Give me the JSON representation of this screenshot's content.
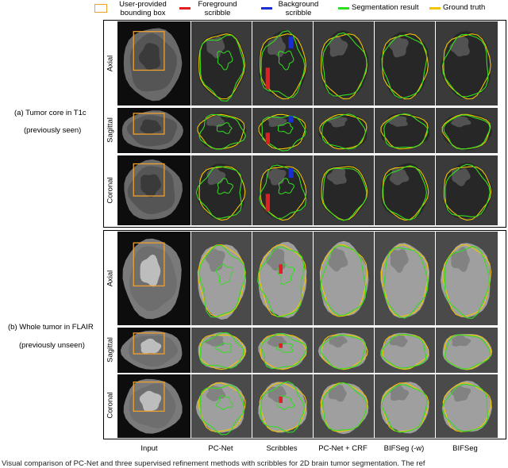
{
  "legend": {
    "bbox_label": "User-provided\nbounding box",
    "foreground_label": "Foreground\nscribble",
    "background_label": "Background\nscribble",
    "segmentation_label": "Segmentation result",
    "ground_truth_label": "Ground truth",
    "colors": {
      "bbox": "#f0a030",
      "foreground": "#e02020",
      "background": "#1a2fd0",
      "segmentation": "#33dd22",
      "ground_truth": "#f2c400"
    }
  },
  "groups": [
    {
      "title": "(a) Tumor core in T1c",
      "subtitle": "(previously seen)"
    },
    {
      "title": "(b) Whole tumor in FLAIR",
      "subtitle": "(previously unseen)"
    }
  ],
  "rows": [
    "Axial",
    "Sagittal",
    "Coronal"
  ],
  "columns": [
    "Input",
    "PC-Net",
    "Scribbles",
    "PC-Net + CRF",
    "BIFSeg (-w)",
    "BIFSeg"
  ],
  "caption": "Visual comparison of PC-Net and three supervised refinement methods with scribbles for 2D brain tumor segmentation. The ref"
}
